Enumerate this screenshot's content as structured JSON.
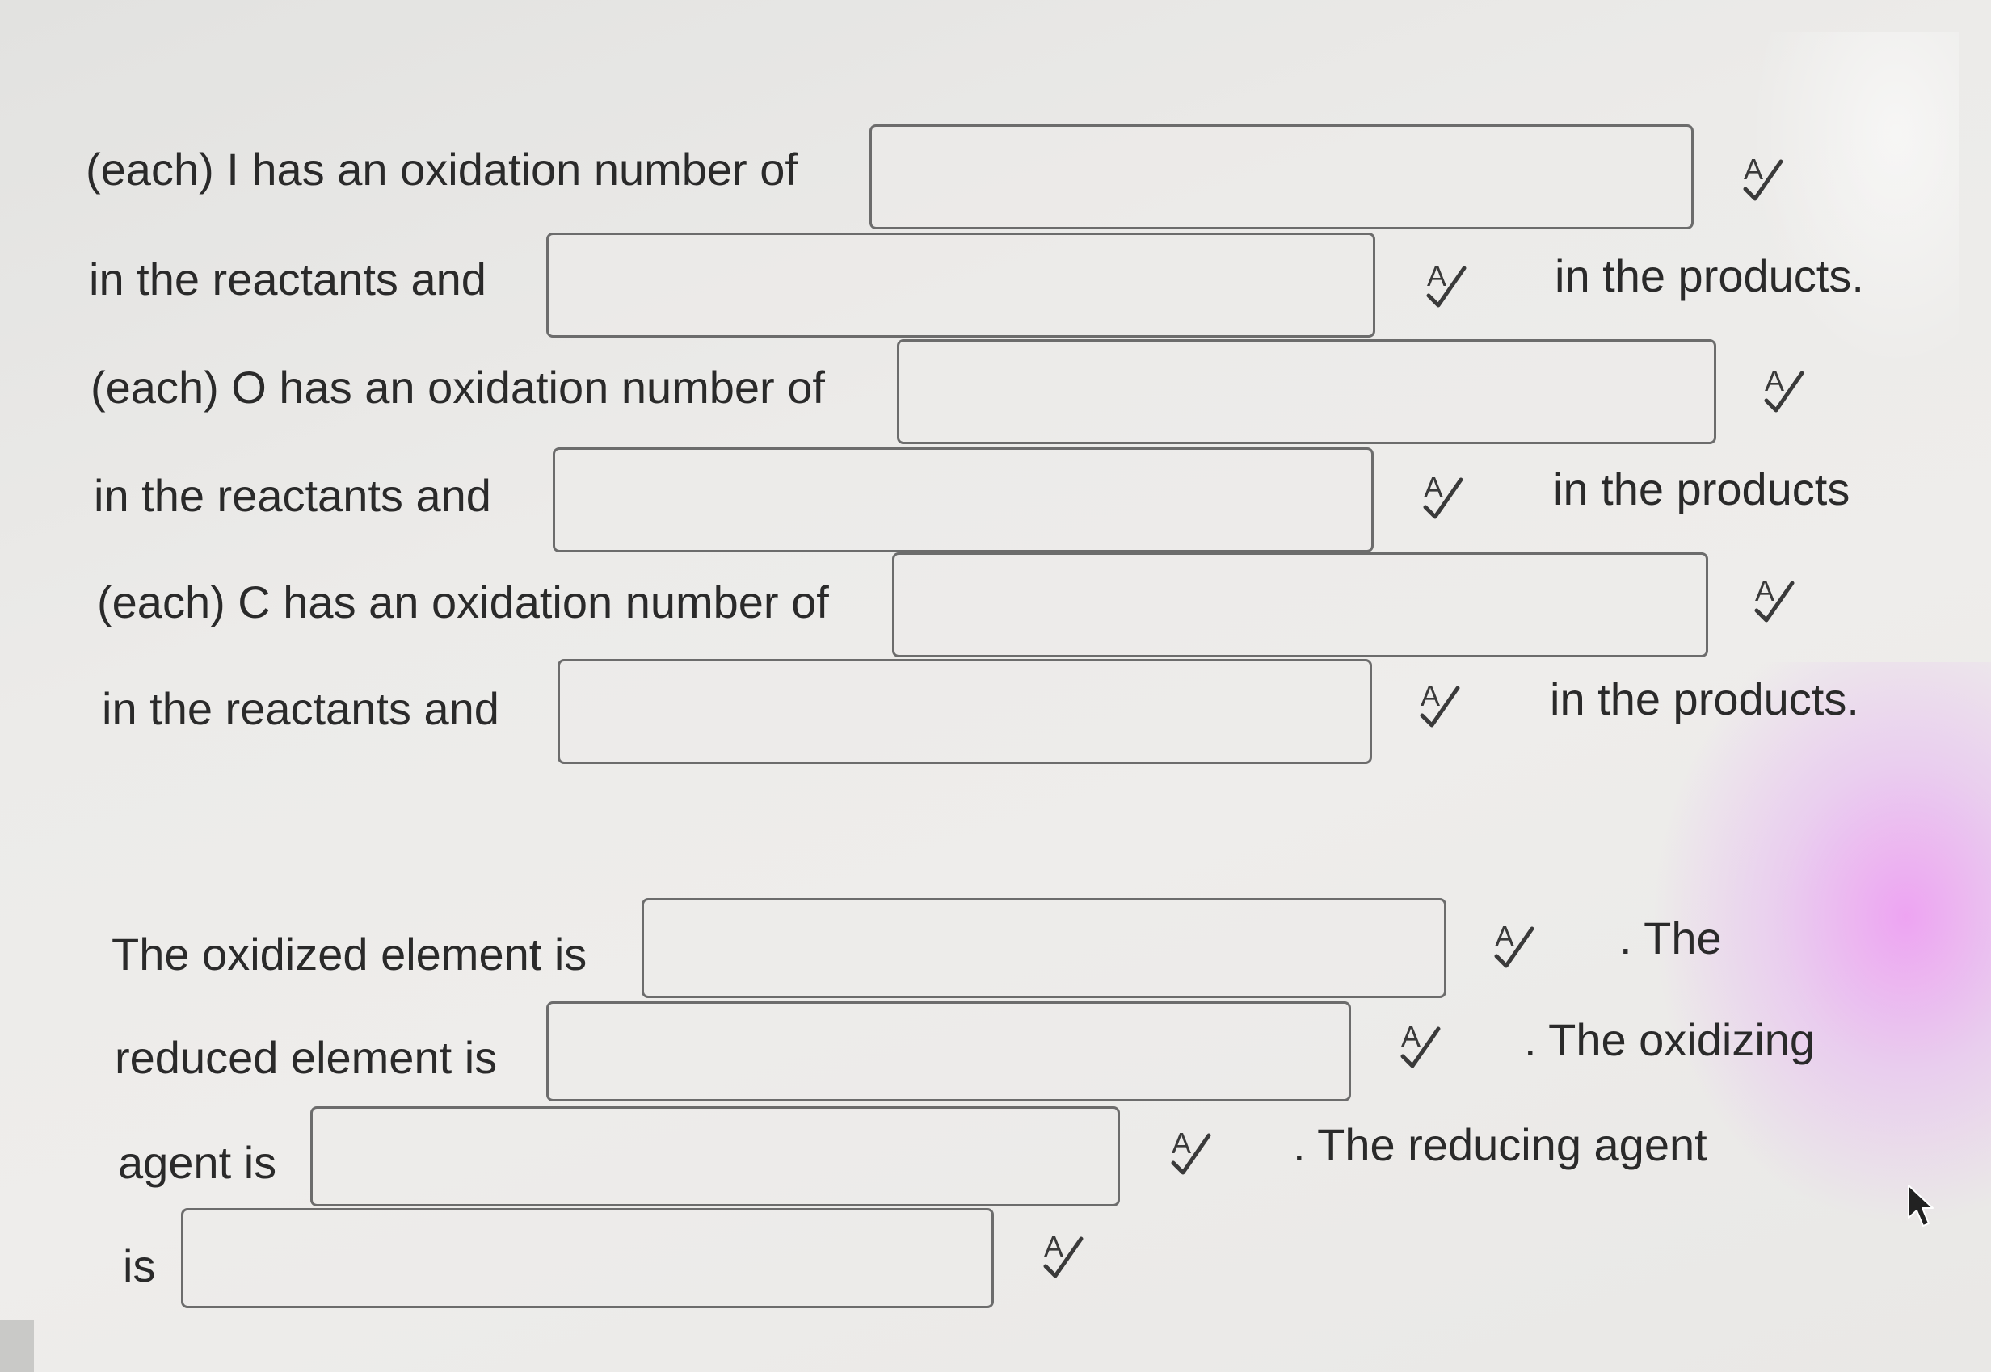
{
  "question": {
    "iodine_line": "(each) I has an oxidation number of",
    "iodine_reactants_line": "in the reactants and",
    "iodine_products_text": "in the products.",
    "oxygen_line": "(each) O has an oxidation number of",
    "oxygen_reactants_line": "in the reactants and",
    "oxygen_products_text": "in the products",
    "carbon_line": "(each) C has an oxidation number of",
    "carbon_reactants_line": "in the reactants and",
    "carbon_products_text": "in the products.",
    "oxidized_label": "The oxidized element is",
    "oxidized_suffix": ". The",
    "reduced_label": "reduced element is",
    "reduced_suffix": ". The oxidizing",
    "oxidizing_label": "agent is",
    "oxidizing_suffix": ". The reducing agent",
    "reducing_label": "is"
  },
  "inputs": {
    "iodine_reactant": "",
    "iodine_product": "",
    "oxygen_reactant": "",
    "oxygen_product": "",
    "carbon_reactant": "",
    "carbon_product": "",
    "oxidized_element": "",
    "reduced_element": "",
    "oxidizing_agent": "",
    "reducing_agent": ""
  },
  "icons": {
    "spellcheck": "spellcheck-icon",
    "pointer": "mouse-pointer-icon"
  },
  "colors": {
    "background": "#ecebe9",
    "text": "#2a2a2a",
    "field_border": "#6c6c6c",
    "icon": "#3a3a3a"
  }
}
